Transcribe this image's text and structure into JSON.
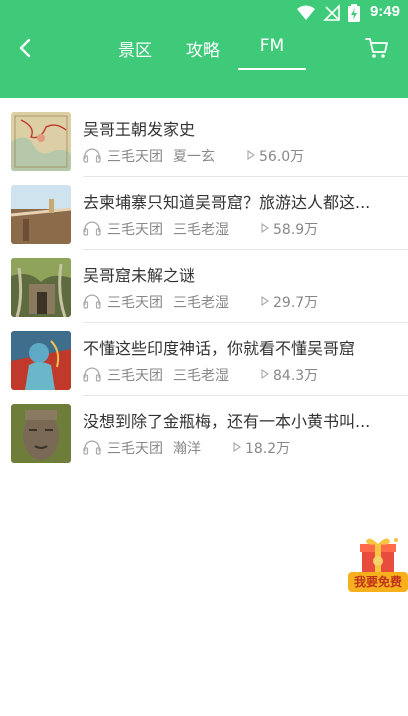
{
  "status_bar": {
    "time": "9:49",
    "icons": [
      "wifi-icon",
      "no-signal-icon",
      "battery-charging-icon"
    ]
  },
  "topbar": {
    "back_icon": "chevron-left-icon",
    "tabs": [
      {
        "label": "景区",
        "active": false
      },
      {
        "label": "攻略",
        "active": false
      },
      {
        "label": "FM",
        "active": true
      }
    ],
    "cart_icon": "cart-icon"
  },
  "colors": {
    "header_green": "#3fca7a",
    "text_primary": "#333333",
    "text_secondary": "#888888"
  },
  "items": [
    {
      "title": "吴哥王朝发家史",
      "group": "三毛天团",
      "host": "夏一玄",
      "plays": "56.0万"
    },
    {
      "title": "去柬埔寨只知道吴哥窟？旅游达人都这...",
      "group": "三毛天团",
      "host": "三毛老湿",
      "plays": "58.9万"
    },
    {
      "title": "吴哥窟未解之谜",
      "group": "三毛天团",
      "host": "三毛老湿",
      "plays": "29.7万"
    },
    {
      "title": "不懂这些印度神话，你就看不懂吴哥窟",
      "group": "三毛天团",
      "host": "三毛老湿",
      "plays": "84.3万"
    },
    {
      "title": "没想到除了金瓶梅，还有一本小黄书叫...",
      "group": "三毛天团",
      "host": "瀚洋",
      "plays": "18.2万"
    }
  ],
  "promo": {
    "label": "我要免费",
    "icon": "gift-box-icon"
  }
}
